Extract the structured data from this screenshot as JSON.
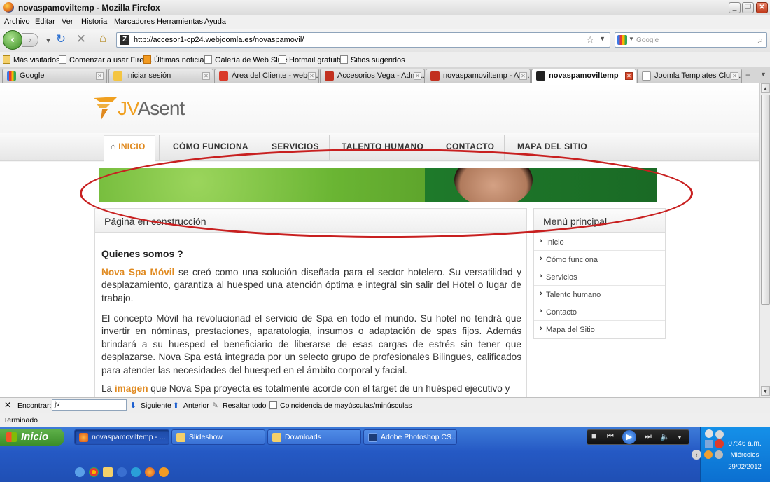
{
  "window": {
    "title": "novaspamoviltemp - Mozilla Firefox"
  },
  "menubar": {
    "items": [
      "Archivo",
      "Editar",
      "Ver",
      "Historial",
      "Marcadores",
      "Herramientas",
      "Ayuda"
    ]
  },
  "navbar": {
    "url": "http://accesor1-cp24.webjoomla.es/novaspamovil/",
    "search_placeholder": "Google"
  },
  "bookmarks": [
    "Más visitados",
    "Comenzar a usar Firef...",
    "Últimas noticias",
    "Galería de Web Slice",
    "Hotmail gratuito",
    "Sitios sugeridos"
  ],
  "tabs": [
    {
      "label": "Google"
    },
    {
      "label": "Iniciar sesión"
    },
    {
      "label": "Área del Cliente - webe..."
    },
    {
      "label": "Accesorios Vega - Admi..."
    },
    {
      "label": "novaspamoviltemp - Ad..."
    },
    {
      "label": "novaspamoviltemp"
    },
    {
      "label": "Joomla Templates Club ..."
    }
  ],
  "site": {
    "logo": {
      "mark": "F",
      "text1": "JV",
      "text2": "Asent"
    },
    "nav": [
      "INICIO",
      "CÓMO FUNCIONA",
      "SERVICIOS",
      "TALENTO HUMANO",
      "CONTACTO",
      "MAPA DEL SITIO"
    ],
    "content": {
      "title": "Página en construcción",
      "heading": "Quienes somos ?",
      "p1_accent": "Nova Spa Móvil",
      "p1_rest": " se creó como una solución diseñada para el sector hotelero. Su versatilidad y desplazamiento, garantiza al huesped una atención óptima e integral sin salir del Hotel o lugar de trabajo.",
      "p2": "El concepto Móvil ha revolucionad el servicio de Spa en todo el mundo. Su hotel no tendrá que invertir en nóminas, prestaciones, aparatologia, insumos o adaptación de spas fijos. Además brindará a su huesped el beneficiario de liberarse de esas cargas de estrés sin tener que desplazarse. Nova Spa está integrada por un selecto grupo de profesionales Bilingues, calificados para atender las necesidades del huesped en el ámbito corporal y facial.",
      "p3_start": "La ",
      "p3_accent": "imagen",
      "p3_rest": " que Nova Spa proyecta es totalmente acorde con el target de un huésped ejecutivo y"
    },
    "sidebar": {
      "title": "Menú principal",
      "items": [
        "Inicio",
        "Cómo funciona",
        "Servicios",
        "Talento humano",
        "Contacto",
        "Mapa del Sitio"
      ]
    }
  },
  "findbar": {
    "label": "Encontrar:",
    "value": "jv",
    "next": "Siguiente",
    "prev": "Anterior",
    "highlight": "Resaltar todo",
    "match_case": "Coincidencia de mayúsculas/minúsculas"
  },
  "status": "Terminado",
  "taskbar": {
    "start": "Inicio",
    "tasks": [
      "novaspamoviltemp - ...",
      "Slideshow",
      "Downloads",
      "Adobe Photoshop CS..."
    ],
    "clock": {
      "time": "07:46 a.m.",
      "day": "Miércoles",
      "date": "29/02/2012"
    }
  },
  "colors": {
    "accent": "#e08a20",
    "annotation": "#c82020",
    "banner_green": "#6fb43a"
  }
}
